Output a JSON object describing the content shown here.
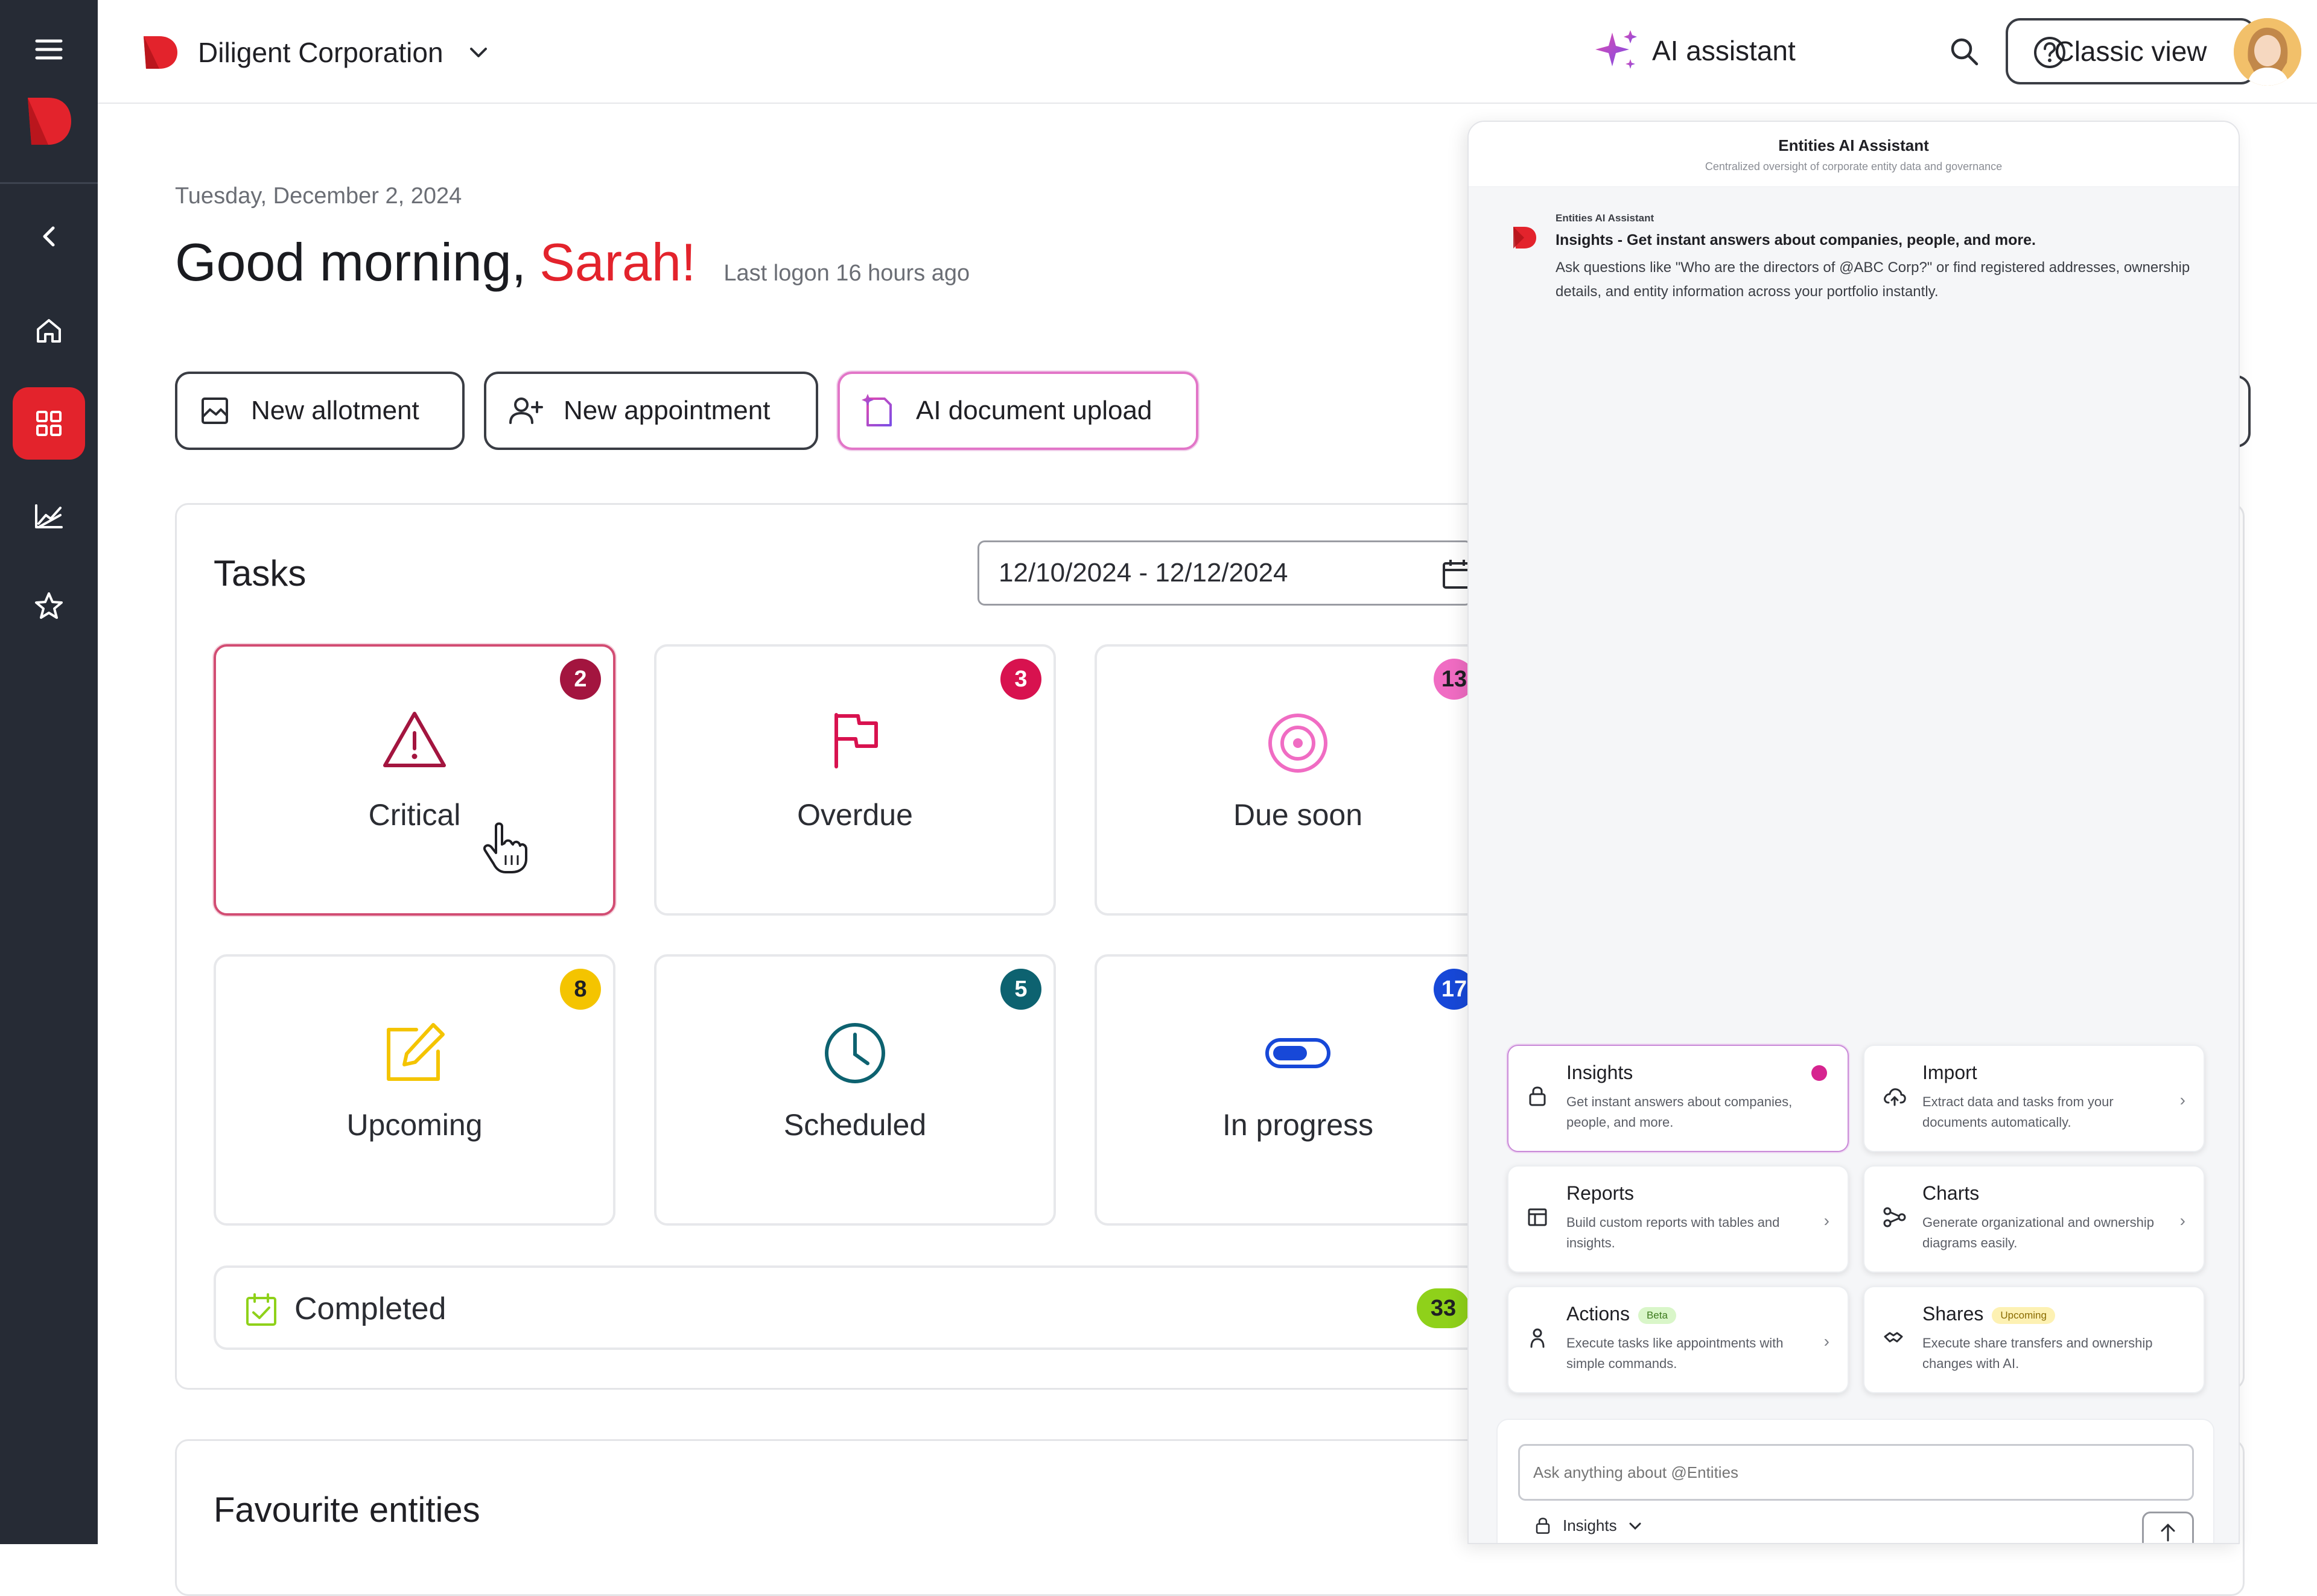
{
  "header": {
    "org_name": "Diligent Corporation",
    "ai_assistant_label": "AI assistant",
    "classic_view_label": "Classic view"
  },
  "greeting": {
    "date": "Tuesday, December 2, 2024",
    "prefix": "Good morning,",
    "name": "Sarah!",
    "last_logon": "Last logon 16 hours ago"
  },
  "actions": {
    "new_allotment": "New allotment",
    "new_appointment": "New appointment",
    "ai_document_upload": "AI document upload"
  },
  "tasks": {
    "title": "Tasks",
    "date_range": "12/10/2024 - 12/12/2024",
    "tiles": [
      {
        "label": "Critical",
        "count": "2",
        "icon": "warning-icon",
        "color": "#a3153f"
      },
      {
        "label": "Overdue",
        "count": "3",
        "icon": "flag-icon",
        "color": "#d8124f"
      },
      {
        "label": "Due soon",
        "count": "13",
        "icon": "target-icon",
        "color": "#f06cc3"
      },
      {
        "label": "Upcoming",
        "count": "8",
        "icon": "edit-icon",
        "color": "#f4c400"
      },
      {
        "label": "Scheduled",
        "count": "5",
        "icon": "clock-icon",
        "color": "#0d6270"
      },
      {
        "label": "In progress",
        "count": "17",
        "icon": "toggle-icon",
        "color": "#1748d8"
      }
    ],
    "completed": {
      "label": "Completed",
      "count": "33",
      "color": "#8fd11a"
    }
  },
  "favourites": {
    "title": "Favourite entities"
  },
  "ai_panel": {
    "title": "Entities AI Assistant",
    "subtitle": "Centralized oversight of corporate entity data and governance",
    "message": {
      "sender": "Entities AI Assistant",
      "headline": "Insights - Get instant answers about companies, people, and more.",
      "body": "Ask questions like \"Who are the directors of @ABC Corp?\" or find registered addresses, ownership details, and entity information across your portfolio instantly."
    },
    "cards": [
      {
        "title": "Insights",
        "desc": "Get instant answers about companies, people, and more.",
        "icon": "lock-icon"
      },
      {
        "title": "Import",
        "desc": "Extract data and tasks from your documents automatically.",
        "icon": "cloud-upload-icon"
      },
      {
        "title": "Reports",
        "desc": "Build custom reports with tables and insights.",
        "icon": "table-icon"
      },
      {
        "title": "Charts",
        "desc": "Generate organizational and ownership diagrams easily.",
        "icon": "org-chart-icon"
      },
      {
        "title": "Actions",
        "desc": "Execute tasks like appointments with simple commands.",
        "icon": "person-icon",
        "pill": "Beta"
      },
      {
        "title": "Shares",
        "desc": "Execute share transfers and ownership changes with AI.",
        "icon": "shares-icon",
        "pill": "Upcoming"
      }
    ],
    "input_placeholder": "Ask anything about @Entities",
    "mode_label": "Insights"
  },
  "colors": {
    "brand_red": "#e3232c",
    "sidebar_bg": "#262b35",
    "ai_gradient_start": "#e14ab0",
    "ai_gradient_end": "#7b4ee6"
  }
}
